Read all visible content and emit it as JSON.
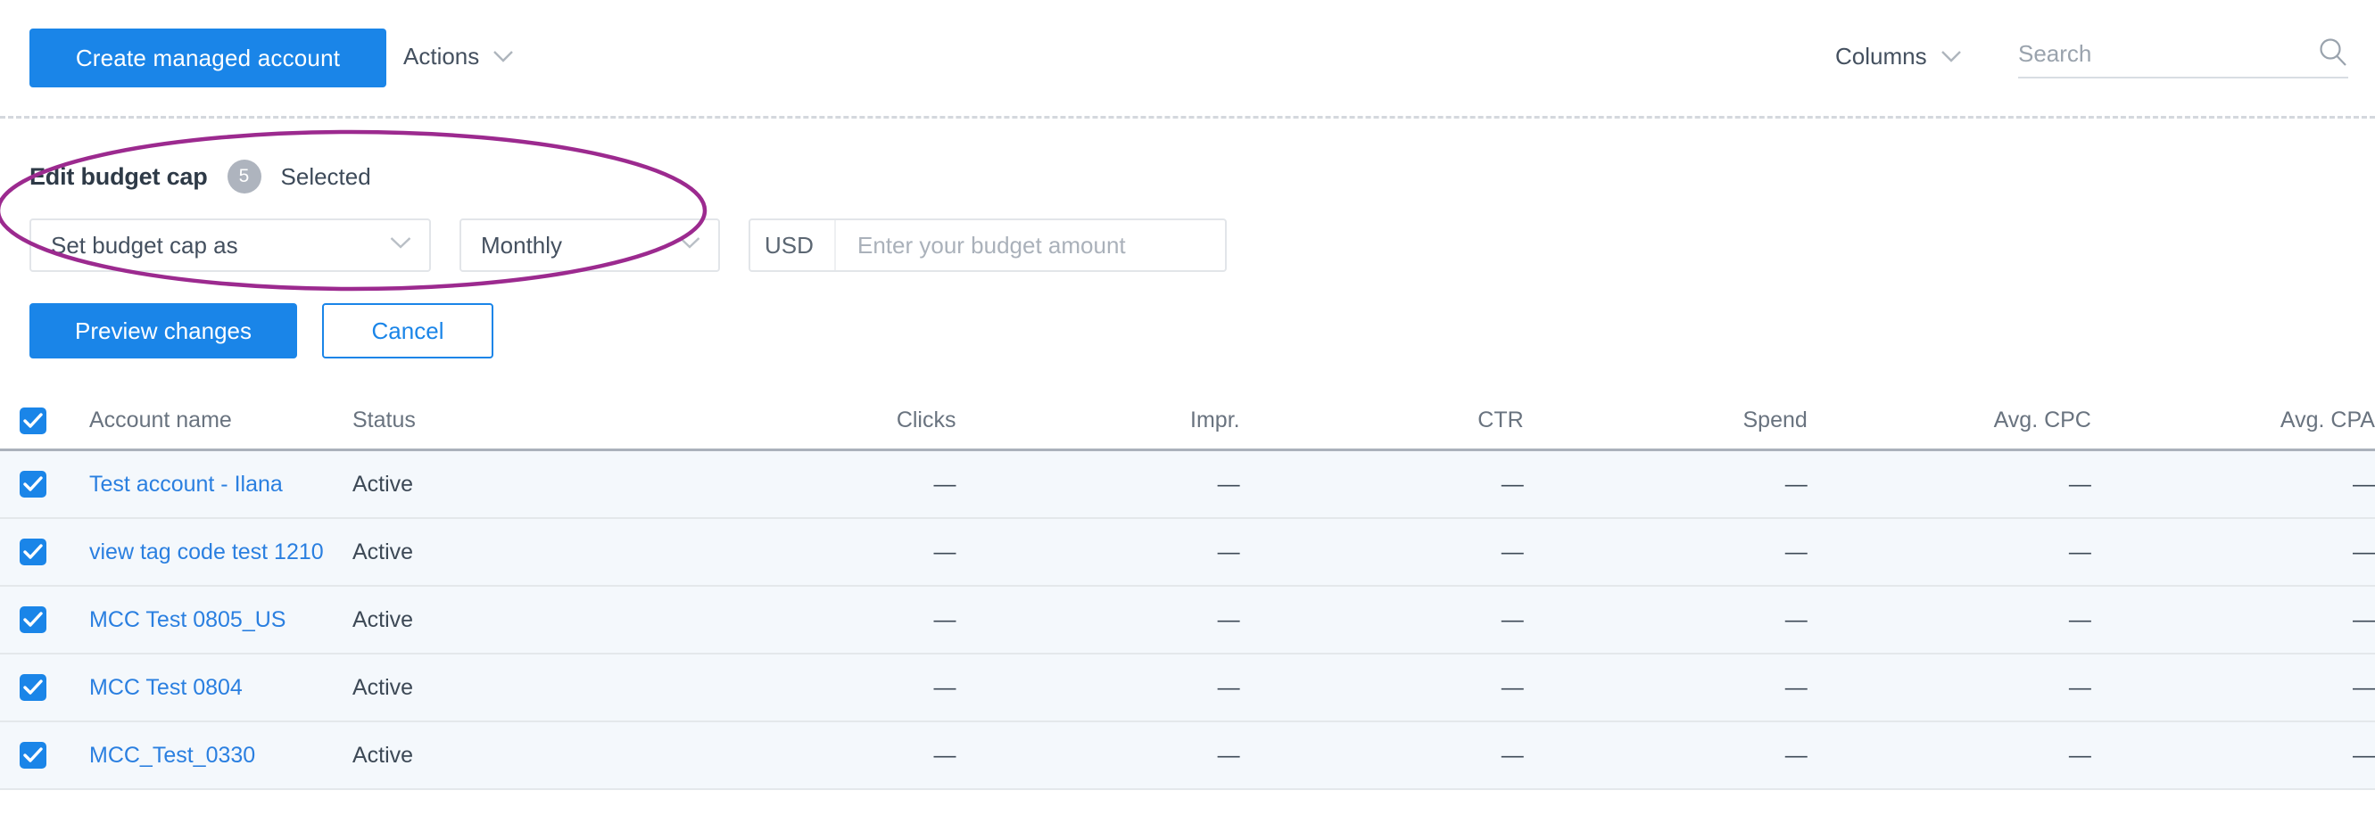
{
  "toolbar": {
    "create_button": "Create managed account",
    "actions_menu": "Actions",
    "columns_menu": "Columns",
    "search_placeholder": "Search",
    "search_value": ""
  },
  "bulk_edit": {
    "title": "Edit budget cap",
    "selected_count": "5",
    "selected_label": "Selected",
    "budget_cap_select": "Set budget cap as",
    "period_select": "Monthly",
    "currency_prefix": "USD",
    "amount_placeholder": "Enter your budget amount",
    "amount_value": "",
    "preview_button": "Preview changes",
    "cancel_button": "Cancel"
  },
  "annotation": {
    "shape": "ellipse-highlight",
    "color": "#9c2a8f"
  },
  "colors": {
    "accent_blue": "#1a85e8",
    "link_blue": "#2a7fe0",
    "row_bg": "#f4f8fc",
    "header_text": "#69737f",
    "annotation_magenta": "#9c2a8f"
  },
  "table": {
    "columns": [
      {
        "label": "Account name",
        "align": "left"
      },
      {
        "label": "Status",
        "align": "left"
      },
      {
        "label": "Clicks",
        "align": "right"
      },
      {
        "label": "Impr.",
        "align": "right"
      },
      {
        "label": "CTR",
        "align": "right"
      },
      {
        "label": "Spend",
        "align": "right"
      },
      {
        "label": "Avg. CPC",
        "align": "right"
      },
      {
        "label": "Avg. CPA",
        "align": "right"
      }
    ],
    "header_checkbox_checked": true,
    "rows": [
      {
        "checked": true,
        "name": "Test account - Ilana",
        "status": "Active",
        "clicks": "—",
        "impr": "—",
        "ctr": "—",
        "spend": "—",
        "avg_cpc": "—",
        "avg_cpa": "—"
      },
      {
        "checked": true,
        "name": "view tag code test 1210",
        "status": "Active",
        "clicks": "—",
        "impr": "—",
        "ctr": "—",
        "spend": "—",
        "avg_cpc": "—",
        "avg_cpa": "—"
      },
      {
        "checked": true,
        "name": "MCC Test 0805_US",
        "status": "Active",
        "clicks": "—",
        "impr": "—",
        "ctr": "—",
        "spend": "—",
        "avg_cpc": "—",
        "avg_cpa": "—"
      },
      {
        "checked": true,
        "name": "MCC Test 0804",
        "status": "Active",
        "clicks": "—",
        "impr": "—",
        "ctr": "—",
        "spend": "—",
        "avg_cpc": "—",
        "avg_cpa": "—"
      },
      {
        "checked": true,
        "name": "MCC_Test_0330",
        "status": "Active",
        "clicks": "—",
        "impr": "—",
        "ctr": "—",
        "spend": "—",
        "avg_cpc": "—",
        "avg_cpa": "—"
      }
    ]
  }
}
